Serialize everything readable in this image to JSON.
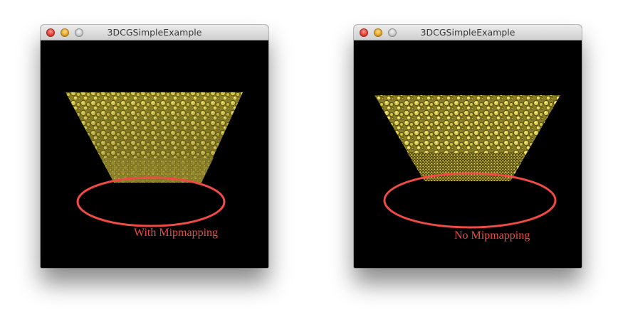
{
  "windows": [
    {
      "title": "3DCGSimpleExample",
      "caption": "With Mipmapping",
      "mipmapping": true
    },
    {
      "title": "3DCGSimpleExample",
      "caption": "No Mipmapping",
      "mipmapping": false
    }
  ],
  "colors": {
    "background": "#000000",
    "texture": "#c9bb3c",
    "texture_dark": "#5a5110",
    "highlight_ellipse": "#ef4a45",
    "caption": "#ef4a45"
  },
  "icons": {
    "close": "close-icon",
    "minimize": "minimize-icon",
    "zoom": "zoom-icon"
  }
}
